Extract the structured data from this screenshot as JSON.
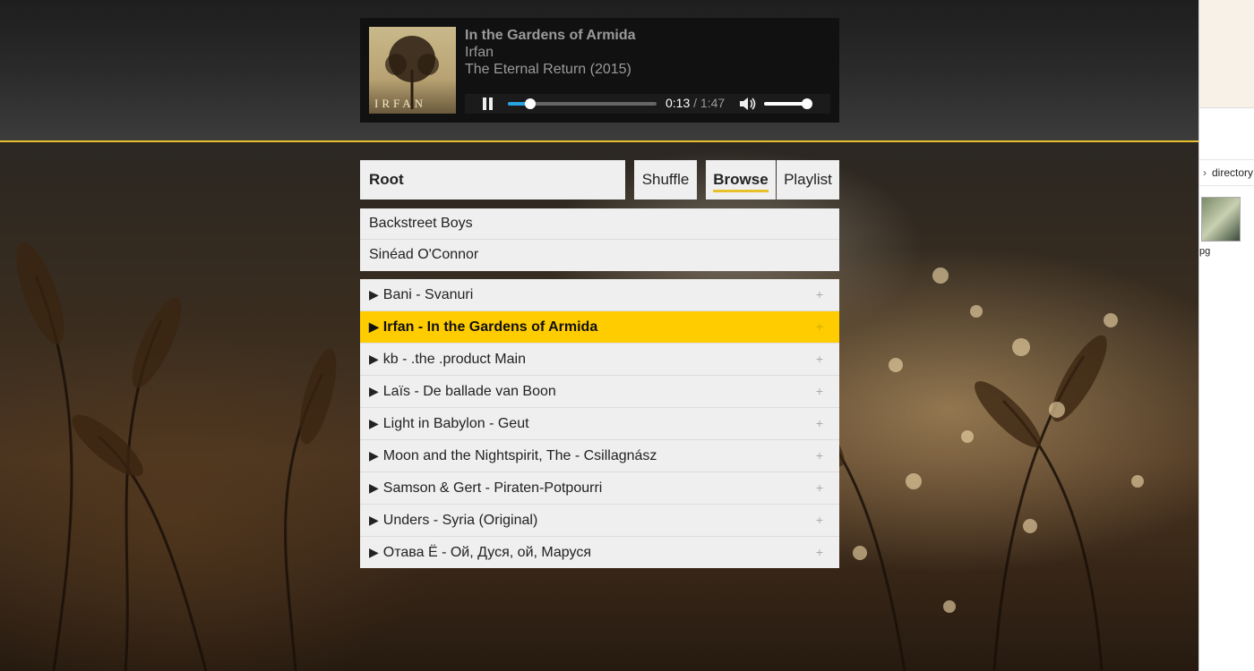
{
  "player": {
    "track_title": "In the Gardens of Armida",
    "artist": "Irfan",
    "album": "The Eternal Return (2015)",
    "cover_logo": "IRFAN",
    "time_current": "0:13",
    "time_separator": "/",
    "time_total": "1:47",
    "seek_progress": 0.15,
    "volume_level": 0.88,
    "accent_color": "#2aa4e0"
  },
  "nav": {
    "path": "Root",
    "shuffle_label": "Shuffle",
    "browse_label": "Browse",
    "playlist_label": "Playlist",
    "active_tab": "Browse"
  },
  "directories": [
    {
      "label": "Backstreet Boys"
    },
    {
      "label": "Sinéad O'Connor"
    }
  ],
  "albums": [
    {
      "label": "Bani - Svanuri",
      "active": false
    },
    {
      "label": "Irfan - In the Gardens of Armida",
      "active": true
    },
    {
      "label": "kb - .the .product Main",
      "active": false
    },
    {
      "label": "Laïs - De ballade van Boon",
      "active": false
    },
    {
      "label": "Light in Babylon - Geut",
      "active": false
    },
    {
      "label": "Moon and the Nightspirit, The - Csillagnász",
      "active": false
    },
    {
      "label": "Samson & Gert - Piraten-Potpourri",
      "active": false
    },
    {
      "label": "Unders - Syria (Original)",
      "active": false
    },
    {
      "label": "Отава Ё - Ой, Дуся, ой, Маруся",
      "active": false
    }
  ],
  "icons": {
    "arrow": "▶",
    "plus": "+"
  },
  "side_window": {
    "breadcrumb": "directory",
    "file_label": "pg"
  },
  "colors": {
    "highlight": "#ffcc00",
    "header_border": "#e8c02c"
  }
}
